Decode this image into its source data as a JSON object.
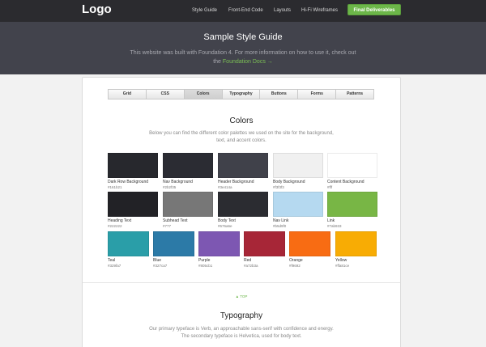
{
  "header": {
    "logo": "Logo",
    "nav": [
      "Style Guide",
      "Front-End Code",
      "Layouts",
      "Hi-Fi Wireframes"
    ],
    "cta": "Final Deliverables"
  },
  "hero": {
    "title": "Sample Style Guide",
    "line1": "This website was built with Foundation 4. For more information on how to use it, check out",
    "line2_prefix": "the",
    "link": "Foundation Docs →"
  },
  "tabs": [
    "Grid",
    "CSS",
    "Colors",
    "Typography",
    "Buttons",
    "Forms",
    "Patterns"
  ],
  "active_tab": "Colors",
  "colors": {
    "title": "Colors",
    "desc1": "Below you can find the different color palettes we used on the site for the background,",
    "desc2": "text, and accent colors.",
    "swatches": [
      {
        "name": "Dark Row Background",
        "hex": "#161b21",
        "color": "#27282d"
      },
      {
        "name": "Nav Background",
        "hex": "#2b2f35",
        "color": "#2b2c33"
      },
      {
        "name": "Header Background",
        "hex": "#3e414a",
        "color": "#40414a"
      },
      {
        "name": "Body Background",
        "hex": "#f3f3f3",
        "color": "#f0f0f0"
      },
      {
        "name": "Content Background",
        "hex": "#fff",
        "color": "#ffffff"
      },
      {
        "name": "Heading Text",
        "hex": "#222222",
        "color": "#222226"
      },
      {
        "name": "Subhead Text",
        "hex": "#777",
        "color": "#777777"
      },
      {
        "name": "Body Text",
        "hex": "#676a6e",
        "color": "#2b2c31"
      },
      {
        "name": "Nav Link",
        "hex": "#b5d9f0",
        "color": "#b5d9f0"
      },
      {
        "name": "Link",
        "hex": "#7ab933",
        "color": "#78b645"
      },
      {
        "name": "Teal",
        "hex": "#329fa7",
        "color": "#2a9ea8"
      },
      {
        "name": "Blue",
        "hex": "#327ca7",
        "color": "#2c7aa7"
      },
      {
        "name": "Purple",
        "hex": "#805cb1",
        "color": "#7d57b2"
      },
      {
        "name": "Red",
        "hex": "#a72b3a",
        "color": "#a72637"
      },
      {
        "name": "Orange",
        "hex": "#f9692",
        "color": "#f86c13"
      },
      {
        "name": "Yellow",
        "hex": "#ffa81ce",
        "color": "#f8ac04"
      }
    ]
  },
  "to_top": "▲ TOP",
  "typography": {
    "title": "Typography",
    "desc1": "Our primary typeface is Verb, an approachable sans-serif with confidence and energy.",
    "desc2": "The secondary typeface is Helvetica, used for body text."
  }
}
